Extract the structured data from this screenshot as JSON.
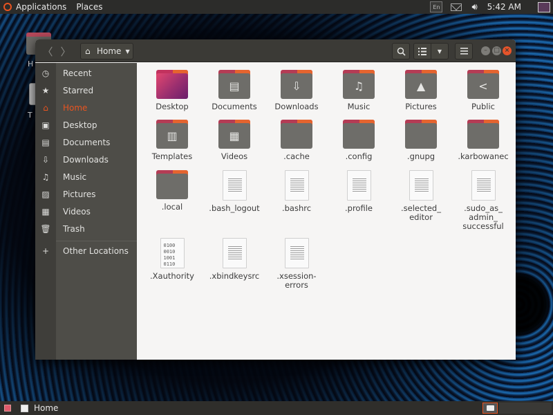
{
  "topbar": {
    "applications": "Applications",
    "places": "Places",
    "keyboard_indicator": "En",
    "clock": "5:42 AM"
  },
  "desktop": {
    "icons": [
      {
        "label": "H",
        "icon": "folder-icon"
      },
      {
        "label": "T",
        "icon": "trash-icon"
      }
    ]
  },
  "window": {
    "path_label": "Home",
    "accent_color": "#e95420"
  },
  "sidebar": {
    "items": [
      {
        "label": "Recent",
        "icon": "recent-icon"
      },
      {
        "label": "Starred",
        "icon": "star-icon"
      },
      {
        "label": "Home",
        "icon": "home-icon",
        "active": true
      },
      {
        "label": "Desktop",
        "icon": "desktop-icon"
      },
      {
        "label": "Documents",
        "icon": "documents-icon"
      },
      {
        "label": "Downloads",
        "icon": "download-icon"
      },
      {
        "label": "Music",
        "icon": "music-icon"
      },
      {
        "label": "Pictures",
        "icon": "pictures-icon"
      },
      {
        "label": "Videos",
        "icon": "videos-icon"
      },
      {
        "label": "Trash",
        "icon": "trash-icon"
      },
      {
        "label": "Other Locations",
        "icon": "plus-icon"
      }
    ]
  },
  "files": [
    {
      "name": "Desktop",
      "type": "folder",
      "glyph": "desktop"
    },
    {
      "name": "Documents",
      "type": "folder",
      "glyph": "documents"
    },
    {
      "name": "Downloads",
      "type": "folder",
      "glyph": "downloads"
    },
    {
      "name": "Music",
      "type": "folder",
      "glyph": "music"
    },
    {
      "name": "Pictures",
      "type": "folder",
      "glyph": "pictures"
    },
    {
      "name": "Public",
      "type": "folder",
      "glyph": "share"
    },
    {
      "name": "Templates",
      "type": "folder",
      "glyph": "templates"
    },
    {
      "name": "Videos",
      "type": "folder",
      "glyph": "videos"
    },
    {
      "name": ".cache",
      "type": "folder",
      "glyph": ""
    },
    {
      "name": ".config",
      "type": "folder",
      "glyph": ""
    },
    {
      "name": ".gnupg",
      "type": "folder",
      "glyph": ""
    },
    {
      "name": ".karbowanec",
      "type": "folder",
      "glyph": ""
    },
    {
      "name": ".local",
      "type": "folder",
      "glyph": ""
    },
    {
      "name": ".bash_logout",
      "type": "text"
    },
    {
      "name": ".bashrc",
      "type": "text"
    },
    {
      "name": ".profile",
      "type": "text"
    },
    {
      "name": ".selected_\neditor",
      "type": "text"
    },
    {
      "name": ".sudo_as_\nadmin_\nsuccessful",
      "type": "text"
    },
    {
      "name": ".Xauthority",
      "type": "binary"
    },
    {
      "name": ".xbindkeysrc",
      "type": "text"
    },
    {
      "name": ".xsession-\nerrors",
      "type": "text"
    }
  ],
  "binary_preview": "0100\n0010\n1001\n0110",
  "bottombar": {
    "task_label": "Home"
  }
}
